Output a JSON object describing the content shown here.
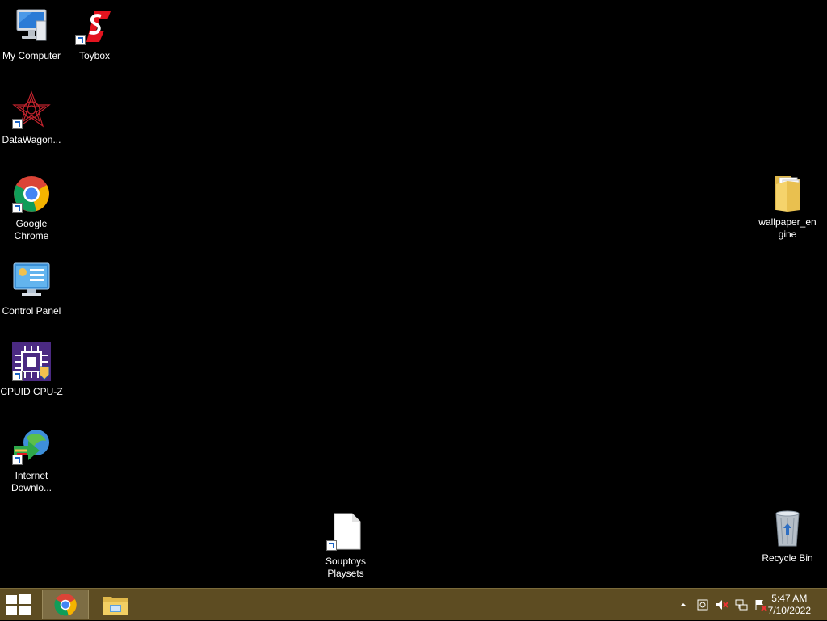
{
  "desktop": {
    "icons": {
      "my_computer": {
        "label": "My Computer",
        "icon": "computer-icon"
      },
      "toybox": {
        "label": "Toybox",
        "icon": "toybox-icon"
      },
      "datawagon": {
        "label": "DataWagon...",
        "icon": "datawagon-icon"
      },
      "chrome": {
        "label": "Google Chrome",
        "icon": "chrome-icon"
      },
      "control_panel": {
        "label": "Control Panel",
        "icon": "control-panel-icon"
      },
      "cpuz": {
        "label": "CPUID CPU-Z",
        "icon": "cpuz-icon"
      },
      "idm": {
        "label": "Internet Downlo...",
        "icon": "internet-download-manager-icon"
      },
      "wallpaper": {
        "label": "wallpaper_engine",
        "icon": "folder-icon"
      },
      "souptoys": {
        "label": "Souptoys Playsets",
        "icon": "file-icon"
      },
      "recycle": {
        "label": "Recycle Bin",
        "icon": "recycle-bin-icon"
      }
    }
  },
  "taskbar": {
    "start": {
      "icon": "windows-start-icon"
    },
    "pinned": [
      "chrome-icon",
      "file-explorer-icon"
    ],
    "tray": [
      "show-hidden-icons-icon",
      "sync-icon",
      "volume-muted-icon",
      "network-icon",
      "action-center-icon"
    ],
    "clock": {
      "time": "5:47 AM",
      "date": "7/10/2022"
    }
  },
  "colors": {
    "taskbar": "#5d4c22",
    "desktop": "#000000"
  }
}
